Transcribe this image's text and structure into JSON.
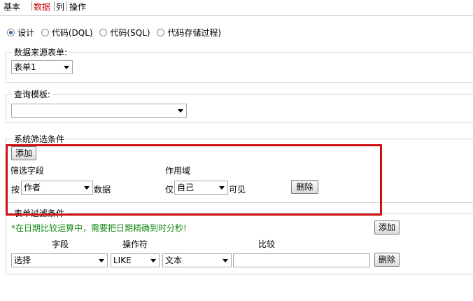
{
  "tabs": [
    {
      "label": "基本"
    },
    {
      "label": "数据"
    },
    {
      "label": "列"
    },
    {
      "label": "操作"
    }
  ],
  "radios": {
    "options": [
      "设计",
      "代码(DQL)",
      "代码(SQL)",
      "代码存储过程)"
    ],
    "selected": "设计"
  },
  "data_source": {
    "legend": "数据来源表单:",
    "select_value": "表单1"
  },
  "query_template": {
    "legend": "查询模板:",
    "select_value": ""
  },
  "system_filter": {
    "legend": "系统筛选条件",
    "add_label": "添加",
    "field_header": "筛选字段",
    "scope_header": "作用域",
    "by_prefix": "按",
    "field_value": "作者",
    "data_suffix": "数据",
    "only_prefix": "仅",
    "scope_value": "自己",
    "visible_suffix": "可见",
    "delete_label": "删除"
  },
  "form_filter": {
    "legend": "表单过滤条件",
    "note": "*在日期比较运算中，需要把日期精确到时分秒!",
    "add_label": "添加",
    "col_field": "字段",
    "col_operator": "操作符",
    "col_compare": "比较",
    "field_value": "选择",
    "operator_value": "LIKE",
    "type_value": "文本",
    "compare_value": "",
    "delete_label": "删除"
  },
  "colors": {
    "active_tab": "#cc0000",
    "highlight_border": "#d01010",
    "note_text": "#1a8a1a"
  }
}
